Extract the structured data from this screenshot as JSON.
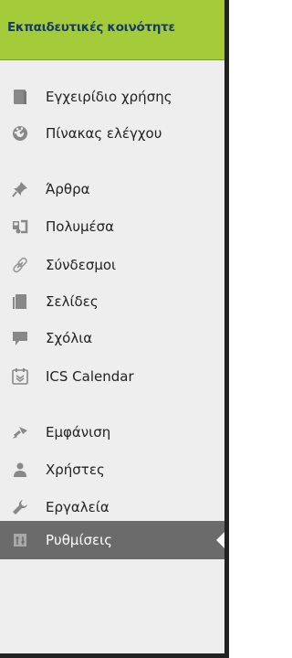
{
  "header": {
    "title": "Εκπαιδευτικές κοινότητε"
  },
  "menu": [
    {
      "label": "Εγχειρίδιο χρήσης",
      "icon": "book-icon"
    },
    {
      "label": "Πίνακας ελέγχου",
      "icon": "dashboard-icon"
    },
    {
      "label": "Άρθρα",
      "icon": "pin-icon"
    },
    {
      "label": "Πολυμέσα",
      "icon": "media-icon"
    },
    {
      "label": "Σύνδεσμοι",
      "icon": "link-icon"
    },
    {
      "label": "Σελίδες",
      "icon": "pages-icon"
    },
    {
      "label": "Σχόλια",
      "icon": "comment-icon"
    },
    {
      "label": "ICS Calendar",
      "icon": "calendar-icon"
    },
    {
      "label": "Εμφάνιση",
      "icon": "brush-icon"
    },
    {
      "label": "Χρήστες",
      "icon": "users-icon"
    },
    {
      "label": "Εργαλεία",
      "icon": "wrench-icon"
    },
    {
      "label": "Ρυθμίσεις",
      "icon": "settings-icon",
      "active": true
    }
  ],
  "colors": {
    "header_bg": "#a4cb39",
    "header_text": "#183a6b",
    "menu_bg": "#eeeeee",
    "icon": "#888888",
    "active_bg": "#6b6b6b"
  }
}
